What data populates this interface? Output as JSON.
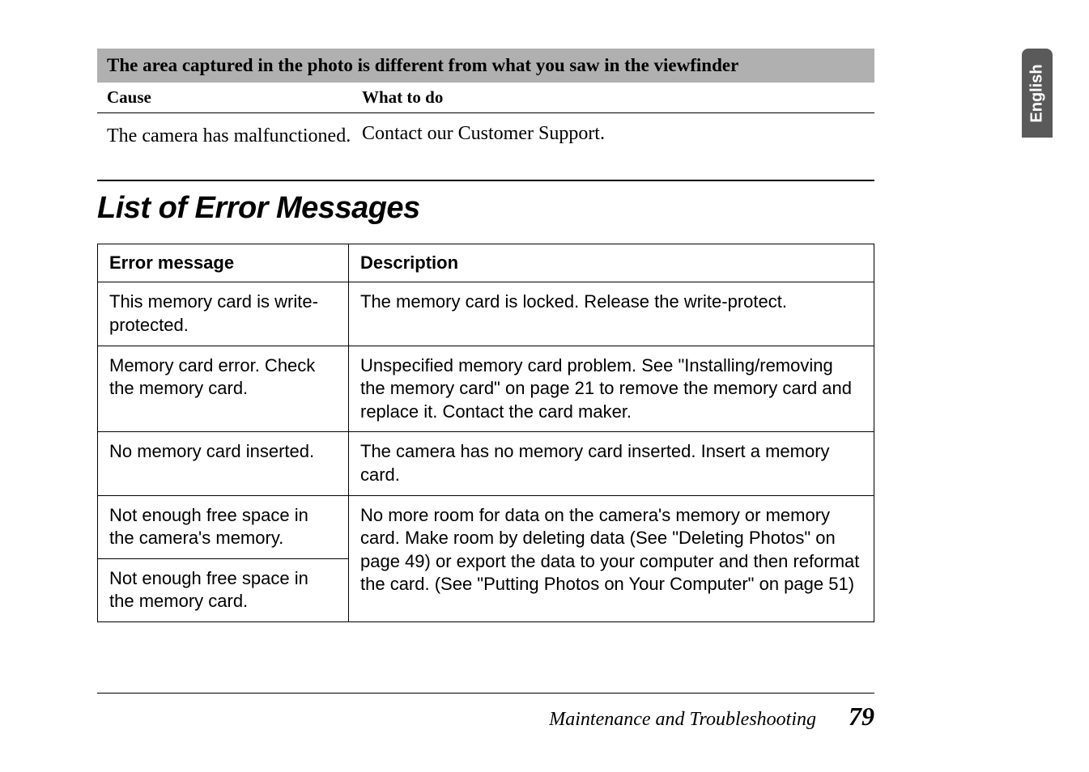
{
  "side_tab": "English",
  "troubleshoot": {
    "header": "The area captured in the photo is different from what you saw in the viewfinder",
    "cause_label": "Cause",
    "what_label": "What to do",
    "cause_text": "The camera has malfunctioned.",
    "what_text": "Contact our Customer Support."
  },
  "section_title": "List of Error Messages",
  "error_table": {
    "header_msg": "Error message",
    "header_desc": "Description",
    "rows": [
      {
        "msg": "This memory card is write-protected.",
        "desc": "The memory card is locked. Release the write-protect."
      },
      {
        "msg": "Memory card error. Check the memory card.",
        "desc": "Unspecified memory card problem. See \"Installing/removing the memory card\" on page 21 to remove the memory card and replace it. Contact the card maker."
      },
      {
        "msg": "No memory card inserted.",
        "desc": "The camera has no memory card inserted. Insert a memory card."
      },
      {
        "msg1": "Not enough free space in the camera's memory.",
        "msg2": "Not enough free space in the memory card.",
        "desc": "No more room for data on the camera's memory or memory card. Make room by deleting data (See \"Deleting Photos\" on page 49) or export the data to your computer and then reformat the card. (See \"Putting Photos on Your Computer\" on page 51)"
      }
    ]
  },
  "footer": {
    "text": "Maintenance and Troubleshooting",
    "page": "79"
  }
}
